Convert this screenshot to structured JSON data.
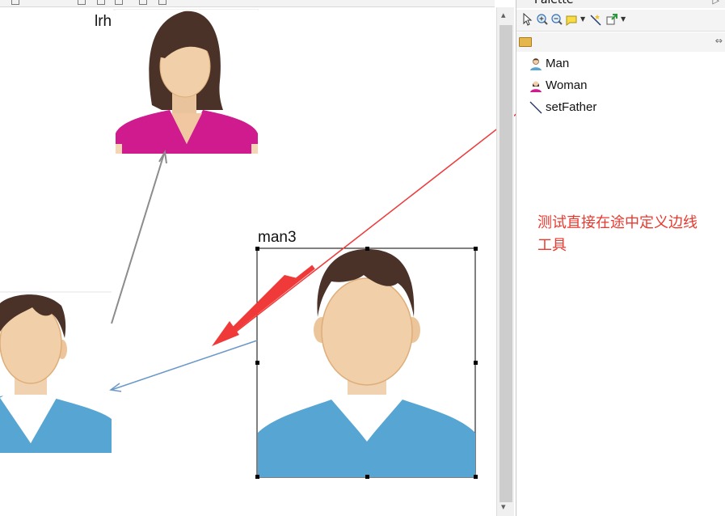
{
  "canvas": {
    "nodes": [
      {
        "label": "lrh",
        "type": "woman"
      },
      {
        "label": "man3",
        "type": "man",
        "selected": true
      },
      {
        "label": "",
        "type": "man"
      }
    ]
  },
  "palette": {
    "title": "Palette",
    "collapse_icon": "triangle-right-icon",
    "toolbar": [
      "select-icon",
      "zoom-in-icon",
      "zoom-out-icon",
      "note-icon",
      "connection-icon",
      "create-icon"
    ],
    "drawer_icon": "folder-open-icon",
    "items": [
      {
        "label": "Man",
        "icon": "man-icon"
      },
      {
        "label": "Woman",
        "icon": "woman-icon"
      },
      {
        "label": "setFather",
        "icon": "line-connection-icon"
      }
    ]
  },
  "annotation": {
    "text_line1": "测试直接在途中定义边线",
    "text_line2": "工具",
    "color": "#e8392f"
  },
  "colors": {
    "shirt_man": "#57a5d2",
    "shirt_woman": "#cf1b8e",
    "hair": "#4b3229",
    "skin": "#f1cfa8",
    "edge_gray": "#8c8c8c",
    "edge_blue": "#6b98c9"
  }
}
